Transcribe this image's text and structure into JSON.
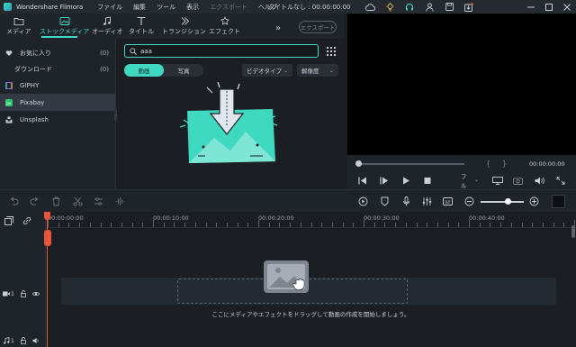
{
  "app": {
    "title": "Wondershare Filmora",
    "project_title": "タイトルなし : 00:00:00:00"
  },
  "menu": [
    "ファイル",
    "編集",
    "ツール",
    "表示",
    "エクスポート",
    "ヘルプ"
  ],
  "tabs": [
    {
      "label": "メディア",
      "icon": "folder-icon"
    },
    {
      "label": "ストックメディア",
      "icon": "stock-media-icon",
      "active": true
    },
    {
      "label": "オーディオ",
      "icon": "music-note-icon"
    },
    {
      "label": "タイトル",
      "icon": "title-t-icon"
    },
    {
      "label": "トランジション",
      "icon": "transition-icon"
    },
    {
      "label": "エフェクト",
      "icon": "effects-icon"
    }
  ],
  "export_label": "エクスポート",
  "sidebar": {
    "items": [
      {
        "label": "お気に入り",
        "count": "(0)",
        "icon": "heart-icon"
      },
      {
        "label": "ダウンロード",
        "count": "(0)"
      },
      {
        "label": "GIPHY",
        "icon": "giphy-icon"
      },
      {
        "label": "Pixabay",
        "icon": "pixabay-icon",
        "active": true
      },
      {
        "label": "Unsplash",
        "icon": "unsplash-icon"
      }
    ]
  },
  "search": {
    "value": "aaa"
  },
  "media_type": {
    "options": [
      "動画",
      "写真"
    ],
    "selected": "動画"
  },
  "filters": {
    "video_type": "ビデオタイプ",
    "resolution": "解像度"
  },
  "preview": {
    "time": "00:00:00:00",
    "quality": "フル",
    "bracket_in": "{",
    "bracket_out": "}"
  },
  "timeline": {
    "ruler_labels": [
      "00:00:00:00",
      "00:00:10:00",
      "00:00:20:00",
      "00:00:30:00",
      "00:00:40:00"
    ],
    "drop_hint": "ここにメディアやエフェクトをドラッグして動画の作成を開始しましょう。",
    "video_track": "1",
    "audio_track": "1"
  },
  "colors": {
    "accent": "#3fd9c2",
    "playhead": "#e8543c",
    "bg": "#1b1f24",
    "panel": "#1f242a"
  }
}
